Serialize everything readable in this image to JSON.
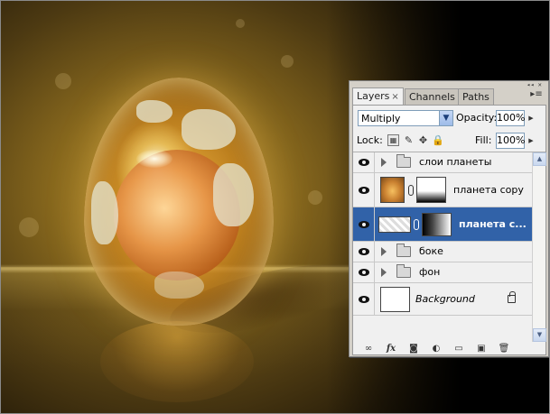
{
  "panel": {
    "tabs": [
      {
        "label": "Layers",
        "close": "×"
      },
      {
        "label": "Channels"
      },
      {
        "label": "Paths"
      }
    ],
    "menu_glyph": "▸≡",
    "blend_mode": "Multiply",
    "opacity_label": "Opacity:",
    "opacity_value": "100%",
    "lock_label": "Lock:",
    "fill_label": "Fill:",
    "fill_value": "100%"
  },
  "layers": [
    {
      "name": "слои планеты",
      "type": "group",
      "visible": true
    },
    {
      "name": "планета copy",
      "type": "layer-with-mask",
      "visible": true
    },
    {
      "name": "планета с...",
      "type": "layer-with-mask",
      "visible": true,
      "selected": true
    },
    {
      "name": "боке",
      "type": "group",
      "visible": true
    },
    {
      "name": "фон",
      "type": "group",
      "visible": true
    },
    {
      "name": "Background",
      "type": "background",
      "visible": true,
      "locked": true
    }
  ],
  "toolbar": {
    "link": "∞",
    "fx": "fx",
    "mask": "◙",
    "adjust": "◐",
    "group": "▭",
    "new": "▣",
    "delete": "🗑"
  },
  "colors": {
    "selection": "#3162a8",
    "panel_bg": "#d4d0c8",
    "list_bg": "#f0f0f0"
  }
}
